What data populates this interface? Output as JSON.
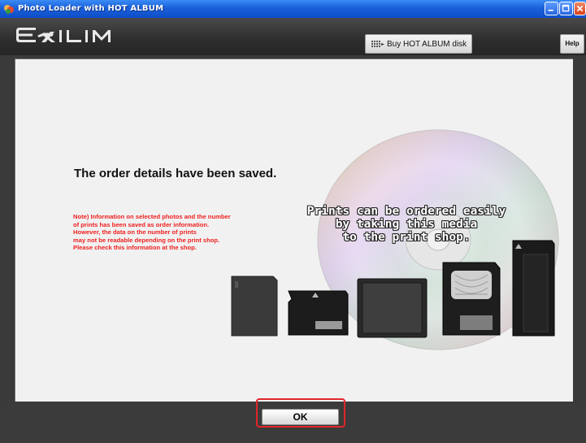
{
  "window": {
    "title": "Photo Loader with HOT ALBUM",
    "icon": "photo-loader-app-icon",
    "controls": [
      "minimize-icon",
      "maximize-icon",
      "close-icon"
    ]
  },
  "header": {
    "logo_text": "EXILIM",
    "buy_button_label": "Buy HOT ALBUM disk",
    "buy_button_icon": "grid-icon",
    "help_label": "Help"
  },
  "content": {
    "main_message": "The order details have been saved.",
    "note_lines": [
      "Note) Information on selected photos and the number",
      "of prints has been saved as order information.",
      "However, the data on the number of prints",
      "may not be readable depending on the print shop.",
      "Please check this information at the shop."
    ],
    "media_text_lines": [
      "Prints can be ordered easily",
      "by taking this media",
      "to the print shop."
    ],
    "media_images": [
      "cd-disc-image",
      "sd-card-image",
      "xd-card-image",
      "compactflash-card-image",
      "smartmedia-card-image",
      "memory-stick-image"
    ]
  },
  "footer": {
    "ok_label": "OK"
  },
  "colors": {
    "titlebar": "#1a5fd9",
    "header": "#2d2d2d",
    "panel": "#f1f1f1",
    "note_text": "#f02020",
    "highlight": "#e0262a"
  }
}
